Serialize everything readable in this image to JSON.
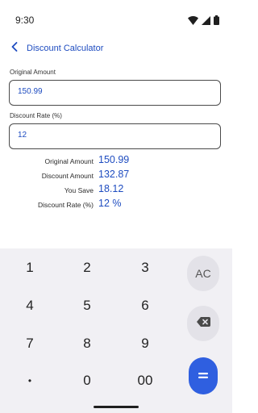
{
  "status": {
    "time": "9:30"
  },
  "app": {
    "title": "Discount Calculator"
  },
  "fields": {
    "original": {
      "label": "Original Amount",
      "value": "150.99"
    },
    "rate": {
      "label": "Discount Rate (%)",
      "value": "12"
    }
  },
  "results": [
    {
      "label": "Original Amount",
      "value": "150.99"
    },
    {
      "label": "Discount Amount",
      "value": "132.87"
    },
    {
      "label": "You Save",
      "value": "18.12"
    },
    {
      "label": "Discount Rate (%)",
      "value": "12 %"
    }
  ],
  "keypad": {
    "keys": [
      "1",
      "2",
      "3",
      "4",
      "5",
      "6",
      "7",
      "8",
      "9",
      "•",
      "0",
      "00"
    ],
    "clear_label": "AC",
    "equals_label": "="
  },
  "icons": {
    "back": "chevron-left-icon",
    "wifi": "wifi-icon",
    "signal": "signal-icon",
    "battery": "battery-icon",
    "backspace": "backspace-icon",
    "equals": "equals-icon"
  },
  "colors": {
    "accent": "#1e4cc0",
    "equals_bg": "#2f5fe0",
    "keypad_bg": "#f1f0f4"
  }
}
